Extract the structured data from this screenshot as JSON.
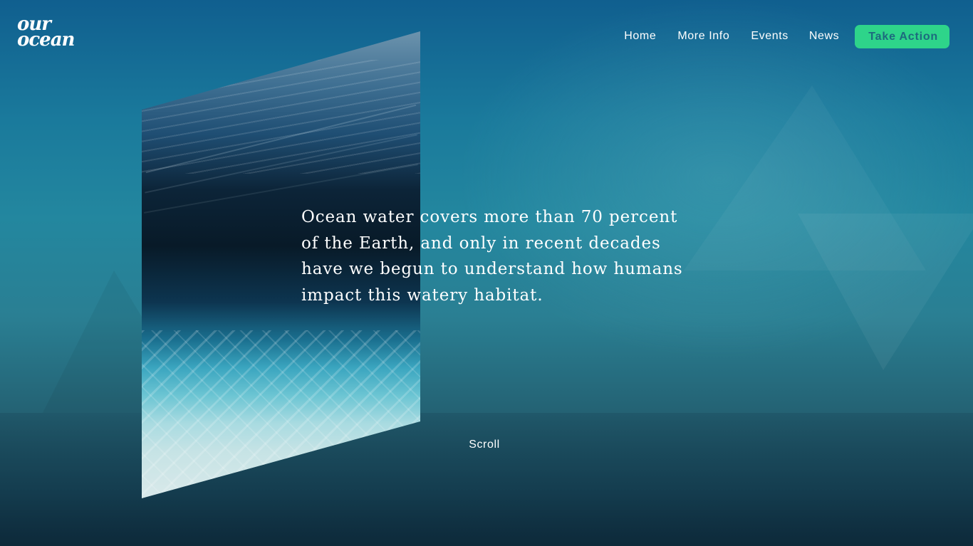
{
  "brand": {
    "logo_line1": "our",
    "logo_line2": "ocean"
  },
  "nav": {
    "items": [
      {
        "label": "Home"
      },
      {
        "label": "More Info"
      },
      {
        "label": "Events"
      },
      {
        "label": "News"
      }
    ],
    "cta_label": "Take Action"
  },
  "hero": {
    "headline": "Ocean water covers more than 70 percent of the Earth, and only in recent decades have we begun to understand how humans impact this watery habitat.",
    "scroll_label": "Scroll"
  },
  "colors": {
    "cta_background": "#2ed48a",
    "cta_text": "#1d6a7e",
    "background_top": "#105f8f",
    "background_bottom": "#173f52"
  },
  "icons": {
    "logo": "our-ocean-logo"
  }
}
